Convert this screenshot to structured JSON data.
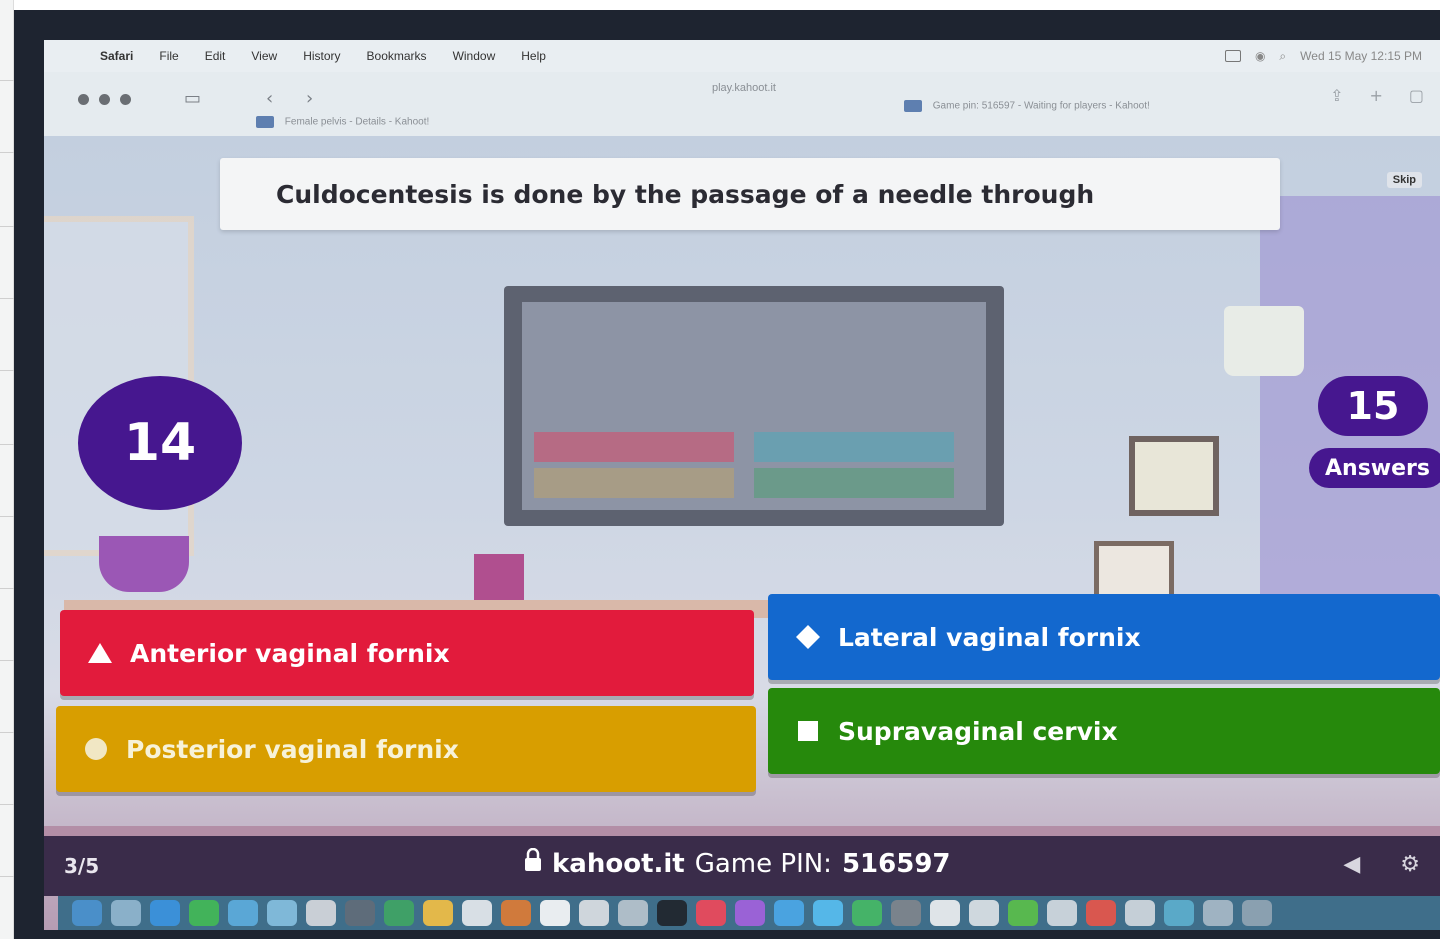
{
  "menubar": {
    "app": "Safari",
    "items": [
      "File",
      "Edit",
      "View",
      "History",
      "Bookmarks",
      "Window",
      "Help"
    ],
    "clock": "Wed 15 May 12:15 PM"
  },
  "browser": {
    "url": "play.kahoot.it",
    "tab_left": "Female pelvis - Details - Kahoot!",
    "tab_right": "Game pin: 516597 - Waiting for players - Kahoot!"
  },
  "game": {
    "question": "Culdocentesis is done by the passage of a needle through",
    "skip_label": "Skip",
    "timer": "14",
    "answers_count": "15",
    "answers_label": "Answers",
    "answers": [
      {
        "label": "Anterior vaginal fornix",
        "shape": "triangle",
        "color": "#e21b3c"
      },
      {
        "label": "Lateral vaginal fornix",
        "shape": "diamond",
        "color": "#1368ce"
      },
      {
        "label": "Posterior vaginal fornix",
        "shape": "circle",
        "color": "#d89e00"
      },
      {
        "label": "Supravaginal cervix",
        "shape": "square",
        "color": "#26890c"
      }
    ],
    "footer": {
      "progress": "3/5",
      "site": "kahoot.it",
      "pin_label": "Game PIN:",
      "pin": "516597"
    }
  },
  "icons": {
    "lock": "lock-icon",
    "volume": "volume-icon",
    "settings": "settings-icon"
  },
  "colors": {
    "kahoot_purple": "#46178f",
    "footer_bg": "#3a2c4a"
  }
}
